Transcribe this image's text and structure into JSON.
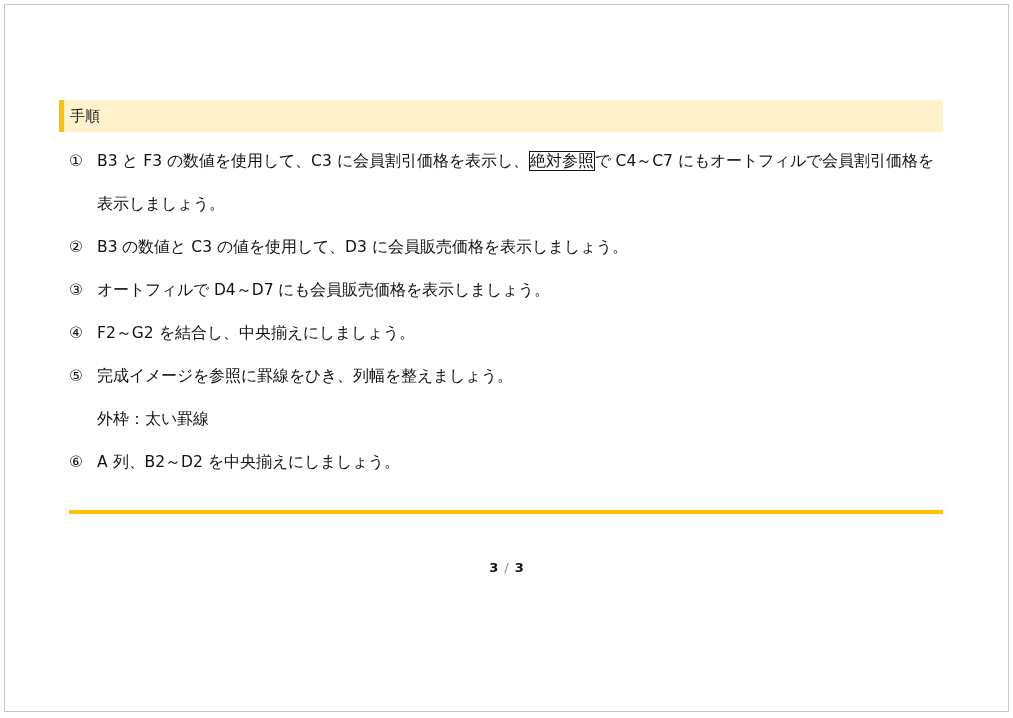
{
  "heading": "手順",
  "steps": [
    {
      "number": "①",
      "parts": [
        {
          "text": "B3 と F3 の数値を使用して、C3 に会員割引価格を表示し、",
          "boxed": false
        },
        {
          "text": "絶対参照",
          "boxed": true
        },
        {
          "text": "で C4～C7 にもオートフィルで会員割引価格を表示しましょう。",
          "boxed": false
        }
      ]
    },
    {
      "number": "②",
      "parts": [
        {
          "text": "B3 の数値と C3 の値を使用して、D3 に会員販売価格を表示しましょう。",
          "boxed": false
        }
      ]
    },
    {
      "number": "③",
      "parts": [
        {
          "text": "オートフィルで D4～D7 にも会員販売価格を表示しましょう。",
          "boxed": false
        }
      ]
    },
    {
      "number": "④",
      "parts": [
        {
          "text": "F2～G2 を結合し、中央揃えにしましょう。",
          "boxed": false
        }
      ]
    },
    {
      "number": "⑤",
      "parts": [
        {
          "text": "完成イメージを参照に罫線をひき、列幅を整えましょう。",
          "boxed": false
        }
      ],
      "note": "外枠：太い罫線"
    },
    {
      "number": "⑥",
      "parts": [
        {
          "text": "A 列、B2～D2 を中央揃えにしましょう。",
          "boxed": false
        }
      ]
    }
  ],
  "page_number": {
    "current": "3",
    "separator": "/",
    "total": "3"
  }
}
